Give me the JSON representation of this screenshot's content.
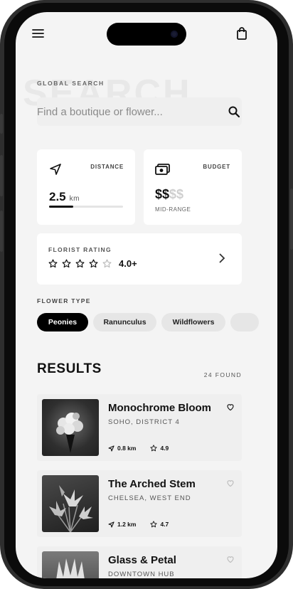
{
  "search": {
    "caption": "GLOBAL SEARCH",
    "placeholder": "Find a boutique or flower...",
    "bg_word": "SEARCH"
  },
  "filters": {
    "distance": {
      "label": "DISTANCE",
      "value": "2.5",
      "unit": "km",
      "level": 0.33
    },
    "budget": {
      "label": "BUDGET",
      "active": "$$",
      "inactive": "$$",
      "caption": "MID-RANGE"
    },
    "rating": {
      "label": "FLORIST RATING",
      "value": "4.0+",
      "stars_filled": 4,
      "stars_total": 5
    }
  },
  "flower_type": {
    "label": "FLOWER TYPE",
    "chips": [
      "Peonies",
      "Ranunculus",
      "Wildflowers"
    ],
    "selected": "Peonies"
  },
  "results": {
    "title": "RESULTS",
    "count": "24 FOUND",
    "items": [
      {
        "name": "Monochrome Bloom",
        "location": "SOHO, DISTRICT 4",
        "distance": "0.8 km",
        "rating": "4.9"
      },
      {
        "name": "The Arched Stem",
        "location": "CHELSEA, WEST END",
        "distance": "1.2 km",
        "rating": "4.7"
      },
      {
        "name": "Glass & Petal",
        "location": "DOWNTOWN HUB",
        "distance": "",
        "rating": ""
      }
    ]
  },
  "icons": {
    "menu": "menu-icon",
    "bag": "bag-icon",
    "search": "search-icon",
    "location": "navigation-arrow-icon",
    "cash": "cash-icon",
    "chevron": "chevron-right-icon",
    "heart": "heart-icon",
    "star": "star-icon"
  },
  "colors": {
    "screen": "#f4f4f4",
    "accent": "#000000",
    "chip": "#e6e6e6"
  }
}
